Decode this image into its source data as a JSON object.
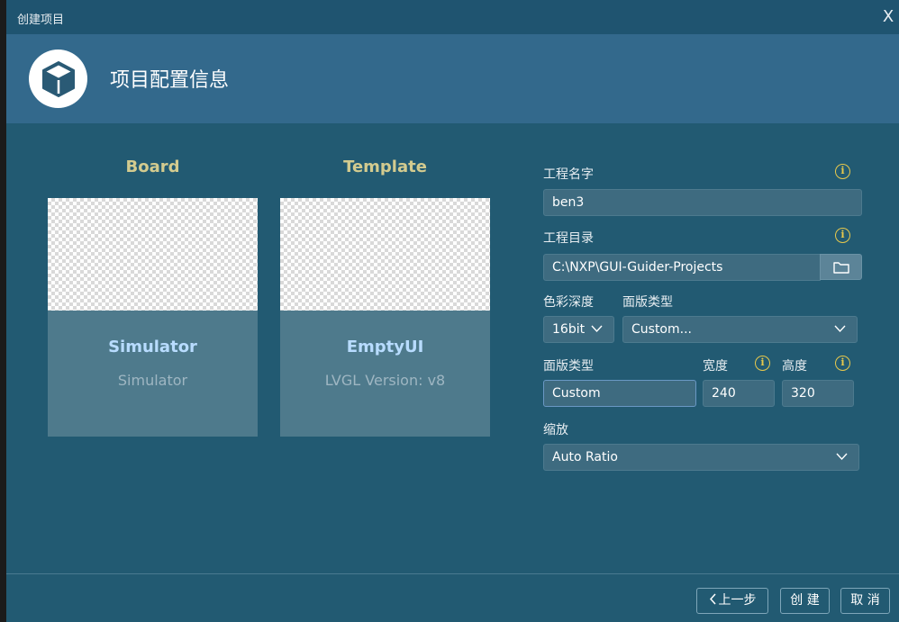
{
  "window": {
    "title": "创建项目",
    "close_label": "X"
  },
  "header": {
    "heading": "项目配置信息",
    "logo_icon": "cube-icon"
  },
  "board": {
    "section_label": "Board",
    "name": "Simulator",
    "subtitle": "Simulator"
  },
  "template": {
    "section_label": "Template",
    "name": "EmptyUI",
    "subtitle": "LVGL Version: v8"
  },
  "form": {
    "project_name_label": "工程名字",
    "project_name_value": "ben3",
    "project_dir_label": "工程目录",
    "project_dir_value": "C:\\NXP\\GUI-Guider-Projects",
    "color_depth_label": "色彩深度",
    "color_depth_value": "16bit",
    "panel_type_label": "面版类型",
    "panel_type_value": "Custom...",
    "panel_type_custom_label": "面版类型",
    "panel_type_custom_value": "Custom",
    "width_label": "宽度",
    "width_value": "240",
    "height_label": "高度",
    "height_value": "320",
    "scale_label": "缩放",
    "scale_value": "Auto Ratio",
    "info_glyph": "i"
  },
  "footer": {
    "prev_label": "上一步",
    "create_label": "创 建",
    "cancel_label": "取 消"
  },
  "colors": {
    "window_bg": "#225a72",
    "header_bg": "#33698c",
    "accent_label": "#d3cb8f",
    "card_title": "#b8dcff",
    "info_icon": "#e8c94c"
  }
}
